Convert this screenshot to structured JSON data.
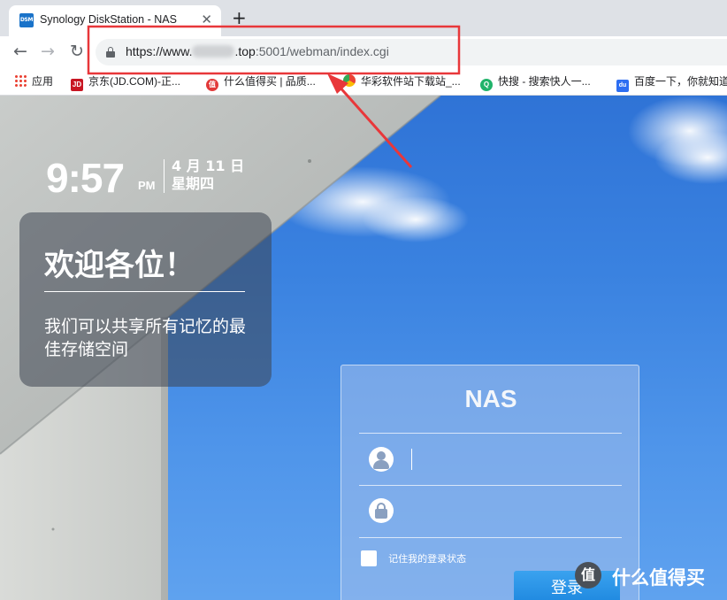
{
  "browser": {
    "tab": {
      "favicon_text": "DSM",
      "title": "Synology DiskStation - NAS",
      "close_glyph": "✕"
    },
    "new_tab_glyph": "+",
    "nav": {
      "back": "←",
      "forward": "→",
      "reload": "↻"
    },
    "url": {
      "prefix": "https://www.",
      "domain_suffix": ".top",
      "path": ":5001/webman/index.cgi"
    },
    "bookmarks": [
      {
        "label": "应用",
        "icon": "apps-grid-icon"
      },
      {
        "label": "京东(JD.COM)-正...",
        "icon_text": "JD",
        "color": "#c81623"
      },
      {
        "label": "什么值得买 | 品质...",
        "icon_text": "值",
        "color": "#e23a3a"
      },
      {
        "label": "华彩软件站下载站_...",
        "icon": "chrome-like-icon"
      },
      {
        "label": "快搜 - 搜索快人一...",
        "icon_text": "Q",
        "color": "#20b36a"
      },
      {
        "label": "百度一下，你就知道",
        "icon_text": "du",
        "color": "#2d6ef2"
      }
    ]
  },
  "dsm": {
    "clock": {
      "time": "9:57",
      "ampm": "PM",
      "date_line1": "4 月 11 日",
      "date_line2": "星期四"
    },
    "welcome": {
      "title": "欢迎各位！",
      "subtitle": "我们可以共享所有记忆的最佳存储空间"
    },
    "login": {
      "title": "NAS",
      "username_value": "",
      "password_value": "",
      "remember_label": "记住我的登录状态",
      "submit_label": "登录"
    }
  },
  "watermark": {
    "logo_text": "值",
    "text": "什么值得买"
  },
  "colors": {
    "annotation_red": "#e8373a",
    "accent_blue": "#1c86de"
  }
}
